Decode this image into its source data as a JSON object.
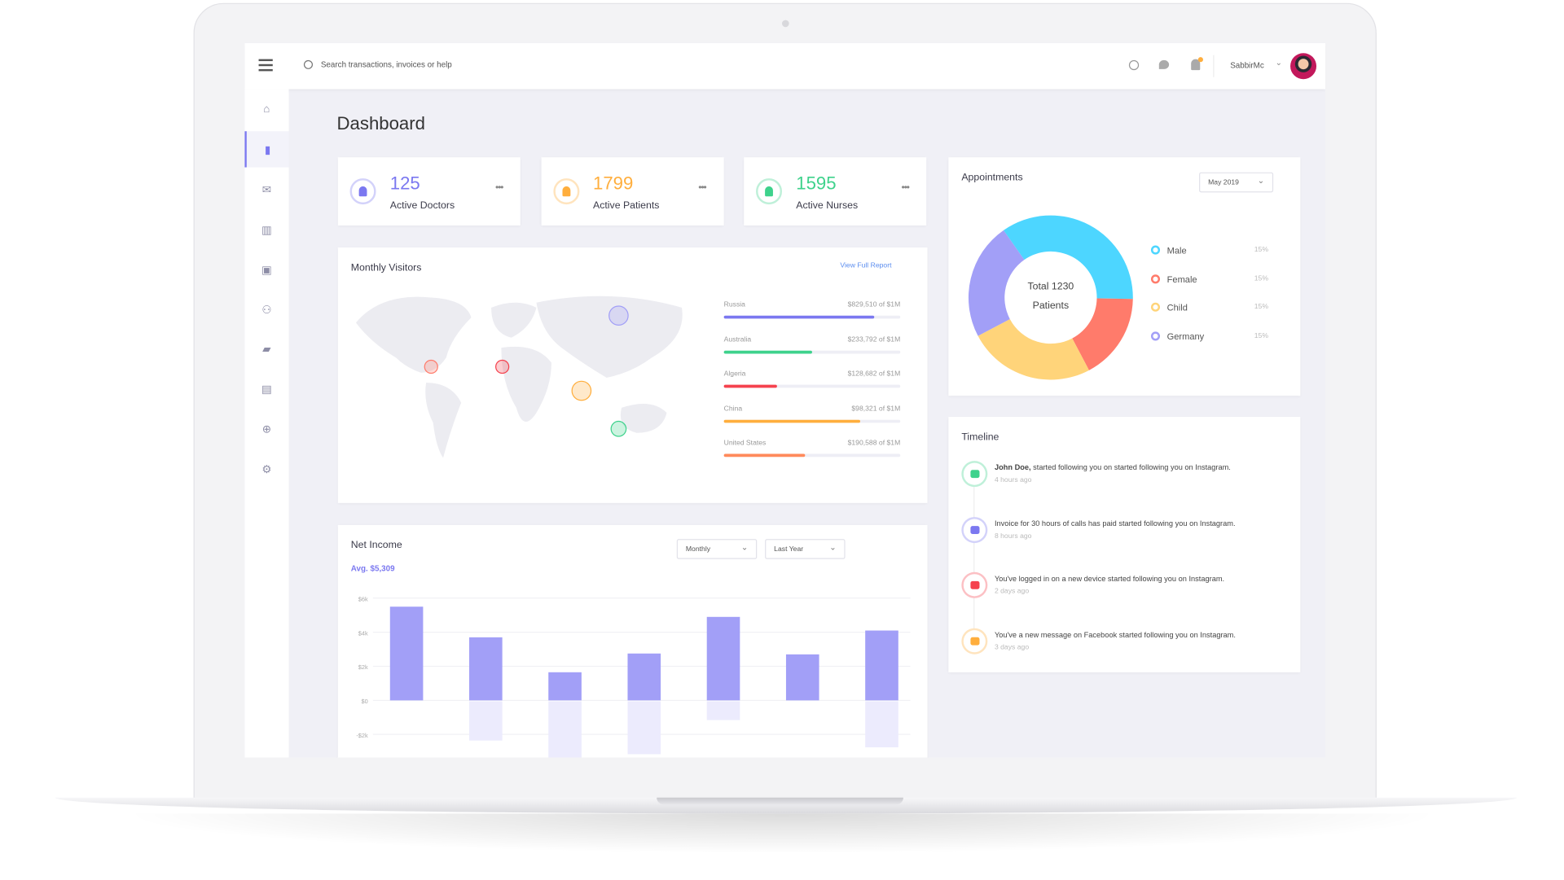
{
  "header": {
    "search_placeholder": "Search transactions, invoices or help",
    "username": "SabbirMc"
  },
  "page_title": "Dashboard",
  "stats": [
    {
      "value": "125",
      "label": "Active Doctors",
      "color": "#7b78f0"
    },
    {
      "value": "1799",
      "label": "Active Patients",
      "color": "#ffae3d"
    },
    {
      "value": "1595",
      "label": "Active Nurses",
      "color": "#3ed28c"
    }
  ],
  "visitors": {
    "title": "Monthly Visitors",
    "link": "View Full Report",
    "countries": [
      {
        "name": "Russia",
        "amount": "$829,510 of $1M",
        "progress": 0.85,
        "color": "#7b78f0"
      },
      {
        "name": "Australia",
        "amount": "$233,792 of $1M",
        "progress": 0.5,
        "color": "#3ed28c"
      },
      {
        "name": "Algeria",
        "amount": "$128,682 of $1M",
        "progress": 0.3,
        "color": "#f5424e"
      },
      {
        "name": "China",
        "amount": "$98,321 of $1M",
        "progress": 0.77,
        "color": "#ffae3d"
      },
      {
        "name": "United States",
        "amount": "$190,588 of $1M",
        "progress": 0.46,
        "color": "#ff8a5b"
      }
    ]
  },
  "income": {
    "title": "Net Income",
    "avg": "Avg. $5,309",
    "period": "Monthly",
    "range": "Last Year"
  },
  "chart_data": {
    "type": "bar",
    "yticks": [
      "$6k",
      "$4k",
      "$2k",
      "$0",
      "-$2k"
    ],
    "ylim": [
      -3,
      6
    ],
    "unit": "k$",
    "series": [
      {
        "values": [
          5.5,
          3.7,
          1.65,
          2.75,
          4.9,
          2.7,
          4.1
        ]
      },
      {
        "values": [
          0,
          -2.3,
          -3.3,
          -3.1,
          -1.1,
          0,
          -2.7
        ]
      }
    ],
    "colors": [
      "#a29ff7",
      "#ecebfd"
    ]
  },
  "appointments": {
    "title": "Appointments",
    "month": "May 2019",
    "center_line1": "Total 1230",
    "center_line2": "Patients",
    "legend": [
      {
        "label": "Male",
        "pct": "15%",
        "color": "#4dd6ff",
        "share": 0.35
      },
      {
        "label": "Female",
        "pct": "15%",
        "color": "#ff7b6b",
        "share": 0.17
      },
      {
        "label": "Child",
        "pct": "15%",
        "color": "#ffd47a",
        "share": 0.25
      },
      {
        "label": "Germany",
        "pct": "15%",
        "color": "#a29ff7",
        "share": 0.23
      }
    ]
  },
  "timeline": {
    "title": "Timeline",
    "items": [
      {
        "bold": "John Doe,",
        "text": " started following you on started following you on Instagram.",
        "time": "4 hours ago",
        "color": "#3ed28c",
        "icon": "user-add-icon"
      },
      {
        "bold": "",
        "text": "Invoice for 30 hours of calls has paid started following you on Instagram.",
        "time": "8 hours ago",
        "color": "#7b78f0",
        "icon": "invoice-icon"
      },
      {
        "bold": "",
        "text": "You've logged in on a new device started following you on Instagram.",
        "time": "2 days ago",
        "color": "#f5424e",
        "icon": "lock-icon"
      },
      {
        "bold": "",
        "text": "You've a new message on Facebook started following you on Instagram.",
        "time": "3 days ago",
        "color": "#ffae3d",
        "icon": "chat-icon"
      }
    ]
  }
}
